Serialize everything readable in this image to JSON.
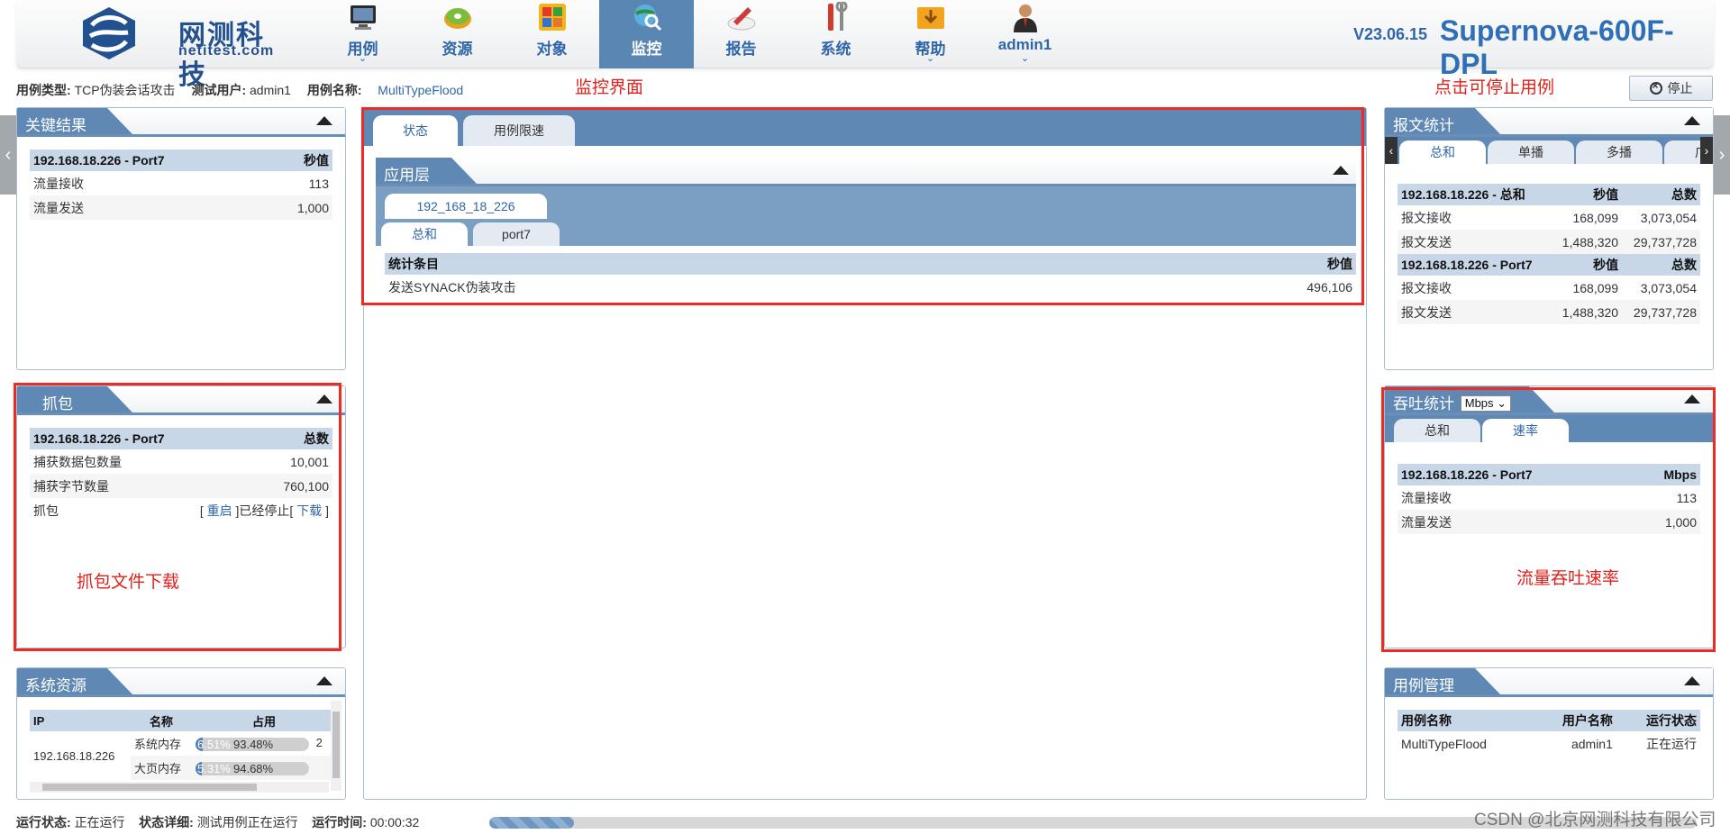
{
  "brand": {
    "name_cn": "网测科技",
    "name_en": "netitest.com",
    "version": "V23.06.15",
    "product": "Supernova-600F-DPL"
  },
  "nav": [
    {
      "label": "用例",
      "icon": "monitor-icon",
      "caret": true
    },
    {
      "label": "资源",
      "icon": "disc-icon",
      "caret": false
    },
    {
      "label": "对象",
      "icon": "blocks-icon",
      "caret": false
    },
    {
      "label": "监控",
      "icon": "globe-search-icon",
      "caret": false,
      "active": true
    },
    {
      "label": "报告",
      "icon": "report-pen-icon",
      "caret": false
    },
    {
      "label": "系统",
      "icon": "tools-icon",
      "caret": false
    },
    {
      "label": "帮助",
      "icon": "folder-download-icon",
      "caret": true
    },
    {
      "label": "admin1",
      "icon": "user-icon",
      "caret": true
    }
  ],
  "info": {
    "type_label": "用例类型:",
    "type_value": "TCP伪装会话攻击",
    "user_label": "测试用户:",
    "user_value": "admin1",
    "name_label": "用例名称:",
    "name_value": "MultiTypeFlood"
  },
  "annotations": {
    "monitor": "监控界面",
    "stop": "点击可停止用例",
    "capture": "抓包文件下载",
    "throughput": "流量吞吐速率"
  },
  "stop_button": "停止",
  "key_results": {
    "title": "关键结果",
    "header": [
      "192.168.18.226 - Port7",
      "秒值"
    ],
    "rows": [
      [
        "流量接收",
        "113"
      ],
      [
        "流量发送",
        "1,000"
      ]
    ]
  },
  "capture": {
    "title": "抓包",
    "header": [
      "192.168.18.226 - Port7",
      "总数"
    ],
    "rows": [
      [
        "捕获数据包数量",
        "10,001"
      ],
      [
        "捕获字节数量",
        "760,100"
      ]
    ],
    "control_label": "抓包",
    "restart": "重启",
    "stopped": "]已经停止[",
    "download": "下载",
    "lb": "[",
    "rb": "]"
  },
  "sysres": {
    "title": "系统资源",
    "header": [
      "IP",
      "名称",
      "占用"
    ],
    "ip": "192.168.18.226",
    "rows": [
      {
        "name": "系统内存",
        "pct_a": "6.51%",
        "pct_b": "93.48%",
        "fill": 0.065
      },
      {
        "name": "大页内存",
        "pct_a": "5.31%",
        "pct_b": "94.68%",
        "fill": 0.053
      }
    ],
    "extra": "2"
  },
  "center": {
    "tabs": [
      "状态",
      "用例限速"
    ],
    "section": "应用层",
    "host_tab": "192_168_18_226",
    "sub_tabs": [
      "总和",
      "port7"
    ],
    "header": [
      "统计条目",
      "秒值"
    ],
    "rows": [
      [
        "发送SYNACK伪装攻击",
        "496,106"
      ]
    ]
  },
  "packet_stats": {
    "title": "报文统计",
    "tabs": [
      "总和",
      "单播",
      "多播",
      "广播"
    ],
    "groups": [
      {
        "header": [
          "192.168.18.226 - 总和",
          "秒值",
          "总数"
        ],
        "rows": [
          [
            "报文接收",
            "168,099",
            "3,073,054"
          ],
          [
            "报文发送",
            "1,488,320",
            "29,737,728"
          ]
        ]
      },
      {
        "header": [
          "192.168.18.226 - Port7",
          "秒值",
          "总数"
        ],
        "rows": [
          [
            "报文接收",
            "168,099",
            "3,073,054"
          ],
          [
            "报文发送",
            "1,488,320",
            "29,737,728"
          ]
        ]
      }
    ]
  },
  "throughput": {
    "title": "吞吐统计",
    "unit": "Mbps",
    "tabs": [
      "总和",
      "速率"
    ],
    "header": [
      "192.168.18.226 - Port7",
      "Mbps"
    ],
    "rows": [
      [
        "流量接收",
        "113"
      ],
      [
        "流量发送",
        "1,000"
      ]
    ]
  },
  "case_mgmt": {
    "title": "用例管理",
    "header": [
      "用例名称",
      "用户名称",
      "运行状态"
    ],
    "rows": [
      [
        "MultiTypeFlood",
        "admin1",
        "正在运行"
      ]
    ]
  },
  "status": {
    "run_label": "运行状态:",
    "run_value": "正在运行",
    "detail_label": "状态详细:",
    "detail_value": "测试用例正在运行",
    "time_label": "运行时间:",
    "time_value": "00:00:32",
    "progress": 0.07
  },
  "watermark": "CSDN @北京网测科技有限公司",
  "colors": {
    "accent": "#5f88b4",
    "link": "#2f66a8",
    "annotation": "#ee2a24"
  }
}
